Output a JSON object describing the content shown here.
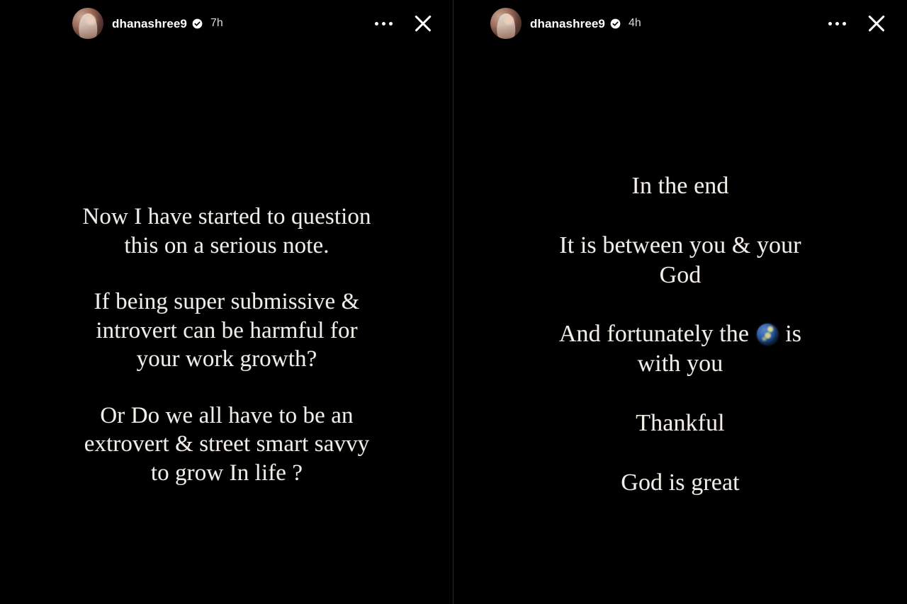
{
  "app": {
    "name": "Instagram Stories Viewer",
    "background_color": "#000000",
    "text_color": "#f2efe9",
    "divider_color": "#2a2a2a"
  },
  "stories": [
    {
      "panel": "left",
      "username": "dhanashree9",
      "verified": true,
      "verified_icon": "verified-badge-icon",
      "timestamp": "7h",
      "more_icon": "more-options-icon",
      "close_icon": "close-icon",
      "avatar_icon": "profile-avatar",
      "paragraphs": [
        "Now I have started to question\nthis on a serious note.",
        "If being super submissive &\nintrovert can be harmful for\nyour work growth?",
        "Or Do we all have to be an\nextrovert & street smart savvy\nto grow In life ?"
      ]
    },
    {
      "panel": "right",
      "username": "dhanashree9",
      "verified": true,
      "verified_icon": "verified-badge-icon",
      "timestamp": "4h",
      "more_icon": "more-options-icon",
      "close_icon": "close-icon",
      "avatar_icon": "profile-avatar",
      "paragraphs": [
        "In the end",
        "It is between you & your\nGod",
        "And fortunately the   is\nwith you",
        "Thankful",
        "God is great"
      ],
      "emoji": {
        "name": "globe-showing-europe-africa",
        "glyph": "🌍",
        "in_paragraph_index": 2
      }
    }
  ]
}
